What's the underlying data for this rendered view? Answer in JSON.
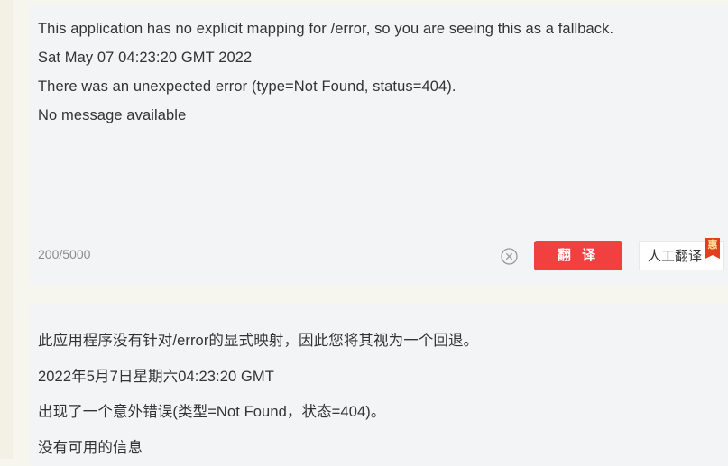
{
  "source": {
    "lines": [
      "This application has no explicit mapping for /error, so you are seeing this as a fallback.",
      "Sat May 07 04:23:20 GMT 2022",
      "There was an unexpected error (type=Not Found, status=404).",
      "No message available"
    ],
    "char_count": "200/5000"
  },
  "actions": {
    "translate_label": "翻 译",
    "human_translate_label": "人工翻译",
    "promo_badge": "惠"
  },
  "result": {
    "lines": [
      "此应用程序没有针对/error的显式映射，因此您将其视为一个回退。",
      "2022年5月7日星期六04:23:20 GMT",
      "出现了一个意外错误(类型=Not Found，状态=404)。",
      "没有可用的信息"
    ]
  },
  "colors": {
    "translate_button": "#f04040",
    "panel_background": "#f3f4f6"
  },
  "icons": {
    "clear": "clear-circle-x-icon"
  }
}
